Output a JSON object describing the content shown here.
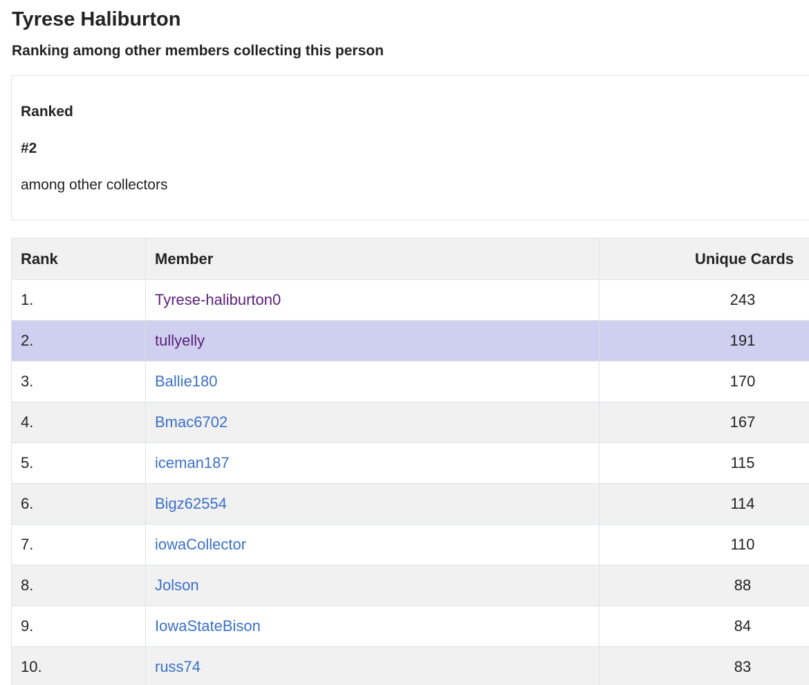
{
  "header": {
    "title": "Tyrese Haliburton",
    "subtitle": "Ranking among other members collecting this person"
  },
  "rank_card": {
    "label": "Ranked",
    "rank": "#2",
    "description": "among other collectors"
  },
  "table": {
    "columns": [
      "Rank",
      "Member",
      "Unique Cards"
    ],
    "rows": [
      {
        "rank": "1.",
        "member": "Tyrese-haliburton0",
        "cards": "243"
      },
      {
        "rank": "2.",
        "member": "tullyelly",
        "cards": "191"
      },
      {
        "rank": "3.",
        "member": "Ballie180",
        "cards": "170"
      },
      {
        "rank": "4.",
        "member": "Bmac6702",
        "cards": "167"
      },
      {
        "rank": "5.",
        "member": "iceman187",
        "cards": "115"
      },
      {
        "rank": "6.",
        "member": "Bigz62554",
        "cards": "114"
      },
      {
        "rank": "7.",
        "member": "iowaCollector",
        "cards": "110"
      },
      {
        "rank": "8.",
        "member": "Jolson",
        "cards": "88"
      },
      {
        "rank": "9.",
        "member": "IowaStateBison",
        "cards": "84"
      },
      {
        "rank": "10.",
        "member": "russ74",
        "cards": "83"
      }
    ]
  },
  "colors": {
    "link": "#3a70c9",
    "visited_link": "#5a1f7a",
    "highlight_row": "#cfcfef",
    "stripe": "#f1f1f1",
    "border": "#dee2e6"
  }
}
